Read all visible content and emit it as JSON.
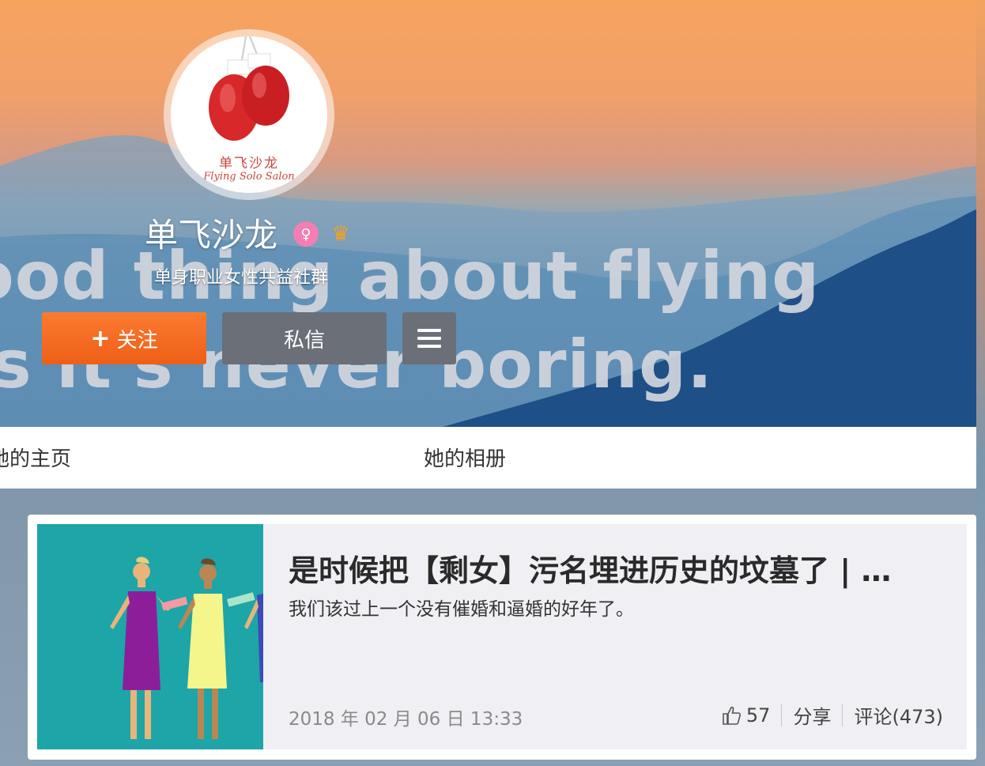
{
  "profile": {
    "name": "单飞沙龙",
    "bio": "单身职业女性共益社群",
    "avatar_cn": "单飞沙龙",
    "avatar_en": "Flying Solo Salon",
    "badges": [
      "female-icon",
      "vip-crown-icon"
    ]
  },
  "cover": {
    "line1": "ood thing about flying",
    "line2": "is it's never boring."
  },
  "actions": {
    "follow": "关注",
    "message": "私信",
    "more": "menu-icon"
  },
  "tabs": [
    "她的主页",
    "她的相册"
  ],
  "post": {
    "title": "是时候把【剩女】污名埋进历史的坟墓了 | …",
    "subtitle": "我们该过上一个没有催婚和逼婚的好年了。",
    "date": "2018 年 02 月 06 日 13:33",
    "likes": "57",
    "share": "分享",
    "comments": "评论(473)"
  },
  "colors": {
    "follow": "#ee5f17",
    "button_gray": "#6b6f78",
    "thumb_bg": "#1da5a8"
  }
}
